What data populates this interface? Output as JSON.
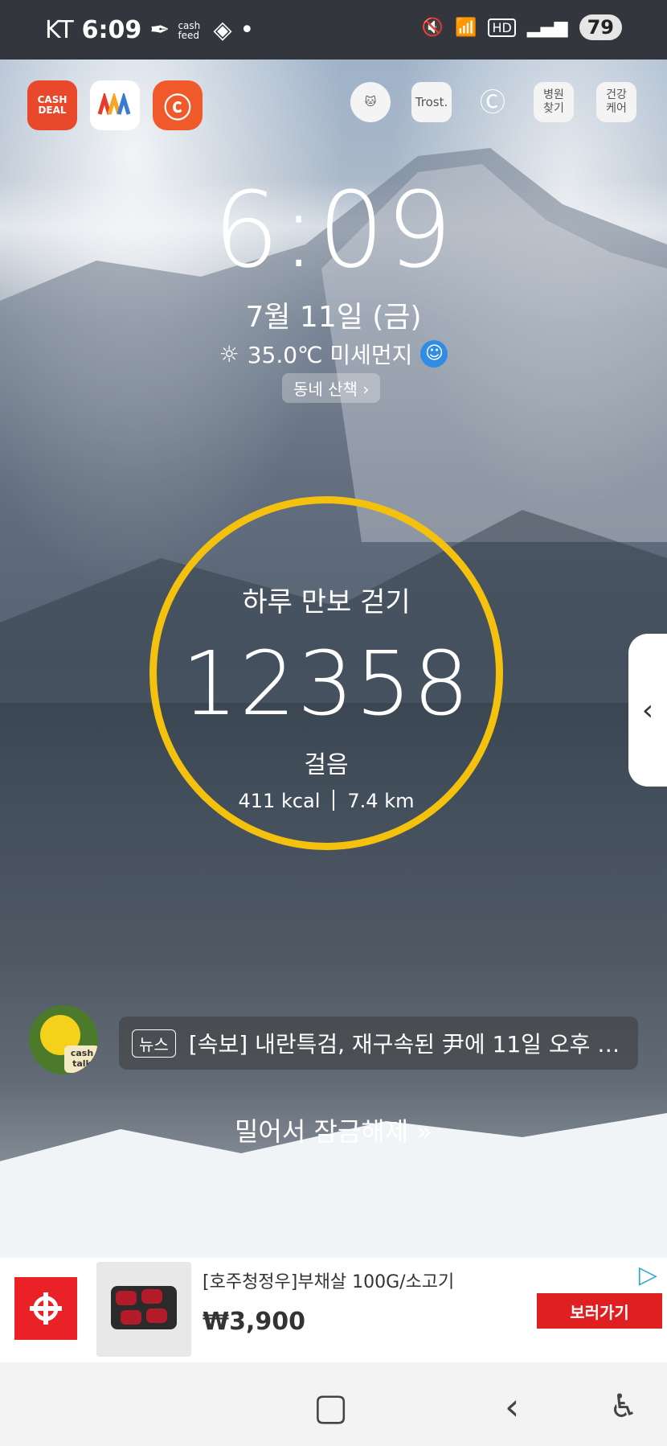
{
  "status_bar": {
    "carrier": "KT",
    "time": "6:09",
    "cashfeed": "cash feed",
    "hd": "HD",
    "battery": "79"
  },
  "apps": {
    "cashdeal": "CASH DEAL",
    "trost": "Trost.",
    "hospital": "병원 찾기",
    "health": "건강 케어"
  },
  "clock": {
    "time": "6:09",
    "date": "7월 11일 (금)",
    "weather": "35.0℃ 미세먼지",
    "walk_button": "동네 산책"
  },
  "pedometer": {
    "title": "하루 만보 걷기",
    "steps": "12358",
    "unit": "걸음",
    "kcal": "411 kcal",
    "distance": "7.4 km",
    "ring_color": "#f4c20d"
  },
  "news": {
    "tag": "뉴스",
    "headline": "[속보] 내란특검, 재구속된 尹에 11일 오후 2...",
    "avatar_badge": "cash talk"
  },
  "unlock": {
    "label": "밀어서 잠금해제"
  },
  "ad": {
    "title": "[호주청정우]부채살 100G/소고기",
    "price": "₩3,900",
    "button": "보러가기"
  }
}
